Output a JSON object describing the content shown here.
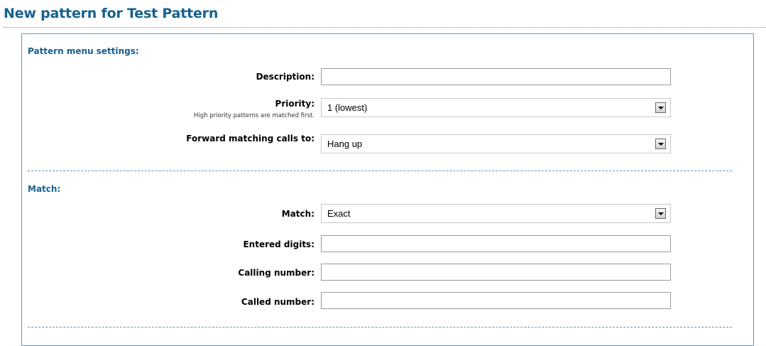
{
  "page": {
    "title": "New pattern for Test Pattern"
  },
  "sections": {
    "menu": {
      "heading": "Pattern menu settings:"
    },
    "match": {
      "heading": "Match:"
    }
  },
  "fields": {
    "description": {
      "label": "Description:",
      "value": ""
    },
    "priority": {
      "label": "Priority:",
      "hint": "High priority patterns are matched first.",
      "selected": "1 (lowest)"
    },
    "forward": {
      "label": "Forward matching calls to:",
      "selected": "Hang up"
    },
    "match": {
      "label": "Match:",
      "selected": "Exact"
    },
    "entered_digits": {
      "label": "Entered digits:",
      "value": ""
    },
    "calling_number": {
      "label": "Calling number:",
      "value": ""
    },
    "called_number": {
      "label": "Called number:",
      "value": ""
    }
  },
  "icons": {
    "dropdown": "chevron-down-icon"
  }
}
